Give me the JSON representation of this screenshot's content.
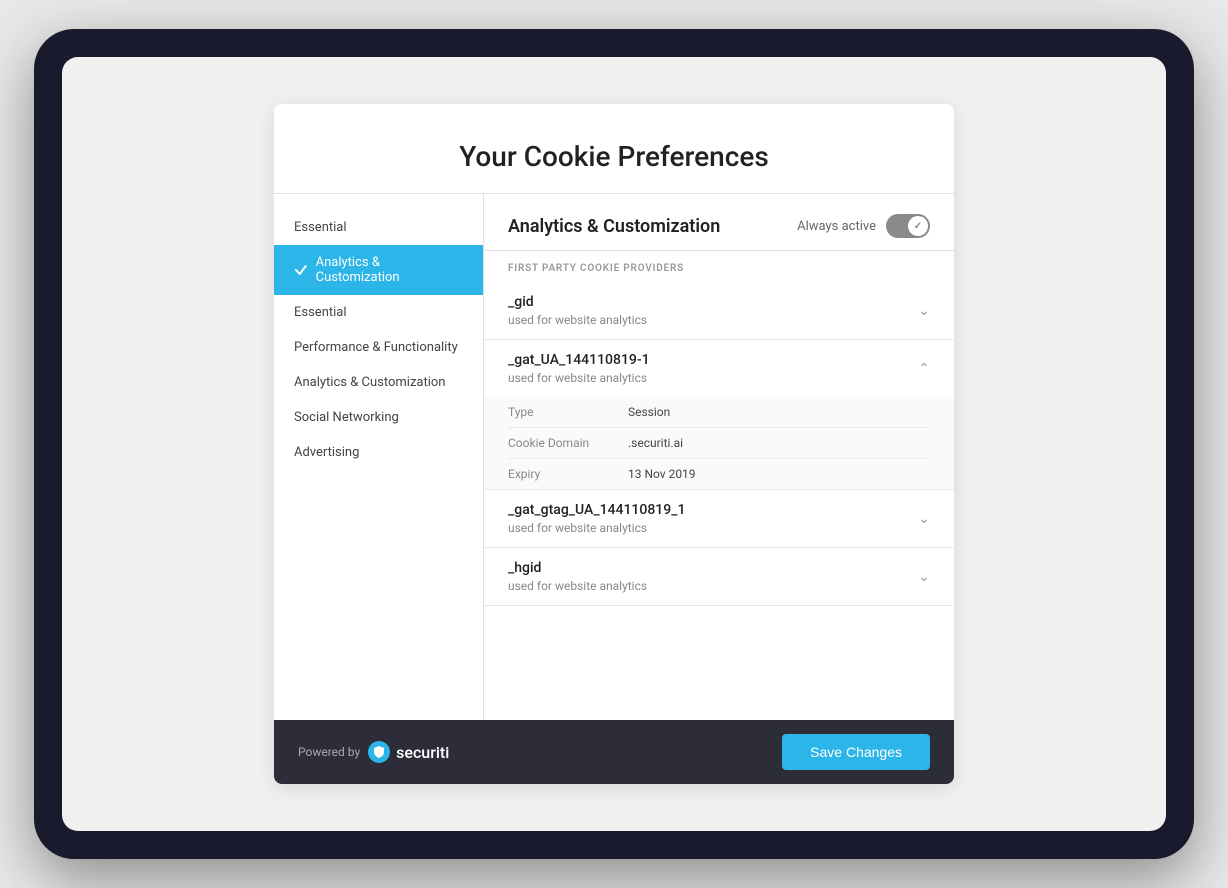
{
  "page": {
    "title": "Your Cookie Preferences"
  },
  "sidebar": {
    "items": [
      {
        "id": "essential-top",
        "label": "Essential",
        "active": false
      },
      {
        "id": "analytics-customization",
        "label": "Analytics & Customization",
        "active": true
      },
      {
        "id": "essential",
        "label": "Essential",
        "active": false
      },
      {
        "id": "performance-functionality",
        "label": "Performance & Functionality",
        "active": false
      },
      {
        "id": "analytics-customization-2",
        "label": "Analytics & Customization",
        "active": false
      },
      {
        "id": "social-networking",
        "label": "Social Networking",
        "active": false
      },
      {
        "id": "advertising",
        "label": "Advertising",
        "active": false
      }
    ]
  },
  "content": {
    "title": "Analytics & Customization",
    "always_active_label": "Always active",
    "section_label": "FIRST PARTY COOKIE PROVIDERS",
    "cookies": [
      {
        "id": "gid",
        "name": "_gid",
        "description": "used for website analytics",
        "expanded": false,
        "details": []
      },
      {
        "id": "gat-ua",
        "name": "_gat_UA_144110819-1",
        "description": "used for website analytics",
        "expanded": true,
        "details": [
          {
            "key": "Type",
            "value": "Session"
          },
          {
            "key": "Cookie Domain",
            "value": ".securiti.ai"
          },
          {
            "key": "Expiry",
            "value": "13 Nov 2019"
          }
        ]
      },
      {
        "id": "gat-gtag",
        "name": "_gat_gtag_UA_144110819_1",
        "description": "used for website analytics",
        "expanded": false,
        "details": []
      },
      {
        "id": "hgid",
        "name": "_hgid",
        "description": "used for website analytics",
        "expanded": false,
        "details": []
      }
    ]
  },
  "footer": {
    "powered_by_label": "Powered by",
    "brand_name": "securiti",
    "save_button_label": "Save Changes"
  }
}
